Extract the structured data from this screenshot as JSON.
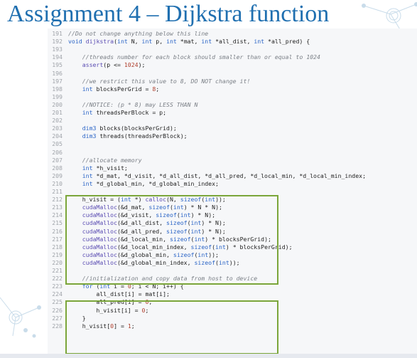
{
  "slide": {
    "title": "Assignment 4 – Dijkstra function"
  },
  "code": {
    "lines": [
      {
        "n": "191",
        "t": "//Do not change anything below this line"
      },
      {
        "n": "192",
        "t": "void dijkstra(int N, int p, int *mat, int *all_dist, int *all_pred) {"
      },
      {
        "n": "193",
        "t": ""
      },
      {
        "n": "194",
        "t": "    //threads number for each block should smaller than or equal to 1024"
      },
      {
        "n": "195",
        "t": "    assert(p <= 1024);"
      },
      {
        "n": "196",
        "t": ""
      },
      {
        "n": "197",
        "t": "    //we restrict this value to 8, DO NOT change it!"
      },
      {
        "n": "198",
        "t": "    int blocksPerGrid = 8;"
      },
      {
        "n": "199",
        "t": ""
      },
      {
        "n": "200",
        "t": "    //NOTICE: (p * 8) may LESS THAN N"
      },
      {
        "n": "201",
        "t": "    int threadsPerBlock = p;"
      },
      {
        "n": "202",
        "t": ""
      },
      {
        "n": "203",
        "t": "    dim3 blocks(blocksPerGrid);"
      },
      {
        "n": "204",
        "t": "    dim3 threads(threadsPerBlock);"
      },
      {
        "n": "205",
        "t": ""
      },
      {
        "n": "206",
        "t": ""
      },
      {
        "n": "207",
        "t": "    //allocate memory"
      },
      {
        "n": "208",
        "t": "    int *h_visit;"
      },
      {
        "n": "209",
        "t": "    int *d_mat, *d_visit, *d_all_dist, *d_all_pred, *d_local_min, *d_local_min_index;"
      },
      {
        "n": "210",
        "t": "    int *d_global_min, *d_global_min_index;"
      },
      {
        "n": "211",
        "t": ""
      },
      {
        "n": "212",
        "t": "    h_visit = (int *) calloc(N, sizeof(int));"
      },
      {
        "n": "213",
        "t": "    cudaMalloc(&d_mat, sizeof(int) * N * N);"
      },
      {
        "n": "214",
        "t": "    cudaMalloc(&d_visit, sizeof(int) * N);"
      },
      {
        "n": "215",
        "t": "    cudaMalloc(&d_all_dist, sizeof(int) * N);"
      },
      {
        "n": "216",
        "t": "    cudaMalloc(&d_all_pred, sizeof(int) * N);"
      },
      {
        "n": "217",
        "t": "    cudaMalloc(&d_local_min, sizeof(int) * blocksPerGrid);"
      },
      {
        "n": "218",
        "t": "    cudaMalloc(&d_local_min_index, sizeof(int) * blocksPerGrid);"
      },
      {
        "n": "219",
        "t": "    cudaMalloc(&d_global_min, sizeof(int));"
      },
      {
        "n": "220",
        "t": "    cudaMalloc(&d_global_min_index, sizeof(int));"
      },
      {
        "n": "221",
        "t": ""
      },
      {
        "n": "222",
        "t": "    //initialization and copy data from host to device"
      },
      {
        "n": "223",
        "t": "    for (int i = 0; i < N; i++) {"
      },
      {
        "n": "224",
        "t": "        all_dist[i] = mat[i];"
      },
      {
        "n": "225",
        "t": "        all_pred[i] = 0;"
      },
      {
        "n": "226",
        "t": "        h_visit[i] = 0;"
      },
      {
        "n": "227",
        "t": "    }"
      },
      {
        "n": "228",
        "t": "    h_visit[0] = 1;"
      }
    ]
  },
  "colors": {
    "title": "#1f6fb0",
    "highlight_box": "#7ba63a",
    "code_background": "#f6f7f9",
    "comment": "#7a7f86",
    "keyword": "#2a64c6",
    "number": "#b0402e"
  },
  "decorations": {
    "top_right": "network-node-icon",
    "bottom_left": "network-node-icon"
  }
}
